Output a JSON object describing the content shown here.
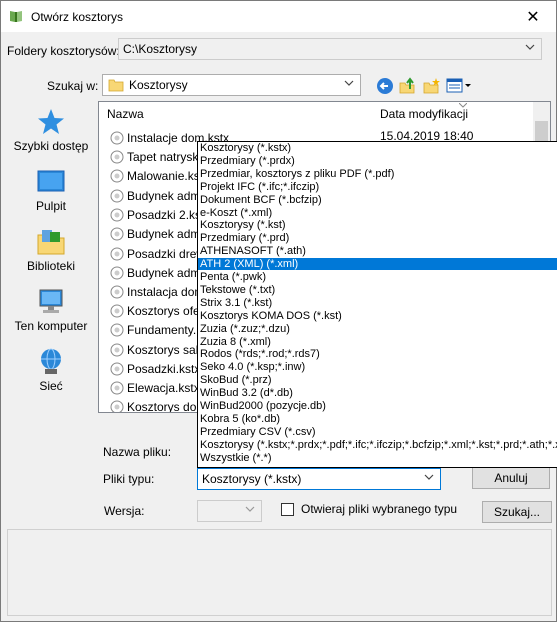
{
  "window": {
    "title": "Otwórz kosztorys"
  },
  "folders": {
    "label": "Foldery kosztorysów:",
    "value": "C:\\Kosztorysy"
  },
  "search": {
    "label": "Szukaj w:",
    "value": "Kosztorysy"
  },
  "places": [
    {
      "label": "Szybki dostęp",
      "icon": "star-icon"
    },
    {
      "label": "Pulpit",
      "icon": "desktop-icon"
    },
    {
      "label": "Biblioteki",
      "icon": "libraries-icon"
    },
    {
      "label": "Ten komputer",
      "icon": "computer-icon"
    },
    {
      "label": "Sieć",
      "icon": "network-icon"
    }
  ],
  "columns": {
    "name": "Nazwa",
    "date": "Data modyfikacji"
  },
  "files": [
    {
      "name": "Instalacje dom.kstx",
      "date": "15.04.2019 18:40"
    },
    {
      "name": "Tapet natrysk"
    },
    {
      "name": "Malowanie.ks"
    },
    {
      "name": "Budynek adm"
    },
    {
      "name": "Posadzki 2.kst"
    },
    {
      "name": "Budynek adm"
    },
    {
      "name": "Posadzki drew"
    },
    {
      "name": "Budynek adm"
    },
    {
      "name": "Instalacja dom"
    },
    {
      "name": "Kosztorys ofe"
    },
    {
      "name": "Fundamenty."
    },
    {
      "name": "Kosztorys sala"
    },
    {
      "name": "Posadzki.kstx"
    },
    {
      "name": "Elewacja.kstx"
    },
    {
      "name": "Kosztorys dom"
    }
  ],
  "filename": {
    "label": "Nazwa pliku:"
  },
  "filetype": {
    "label": "Pliki typu:",
    "value": "Kosztorysy (*.kstx)",
    "options": [
      "Kosztorysy (*.kstx)",
      "Przedmiary (*.prdx)",
      "Przedmiar, kosztorys z pliku PDF (*.pdf)",
      "Projekt IFC (*.ifc;*.ifczip)",
      "Dokument BCF (*.bcfzip)",
      "e-Koszt (*.xml)",
      "Kosztorysy (*.kst)",
      "Przedmiary (*.prd)",
      "ATHENASOFT (*.ath)",
      "ATH 2 (XML) (*.xml)",
      "Penta (*.pwk)",
      "Tekstowe (*.txt)",
      "Strix 3.1 (*.kst)",
      "Kosztorys KOMA DOS (*.kst)",
      "Zuzia (*.zuz;*.dzu)",
      "Zuzia 8 (*.xml)",
      "Rodos (*rds;*.rod;*.rds7)",
      "Seko 4.0 (*.ksp;*.inw)",
      "SkoBud (*.prz)",
      "WinBud 3.2 (d*.db)",
      "WinBud2000 (pozycje.db)",
      "Kobra 5 (ko*.db)",
      "Przedmiary CSV (*.csv)",
      "Kosztorysy (*.kstx;*.prdx;*.pdf;*.ifc;*.ifczip;*.bcfzip;*.xml;*.kst;*.prd;*.ath;*.xml;",
      "Wszystkie (*.*)"
    ],
    "selected_index": 9
  },
  "version": {
    "label": "Wersja:"
  },
  "checkbox": {
    "label": "Otwieraj pliki wybranego typu"
  },
  "buttons": {
    "cancel": "Anuluj",
    "search": "Szukaj..."
  },
  "colors": {
    "selection": "#0078d7",
    "folder": "#f8d775"
  }
}
